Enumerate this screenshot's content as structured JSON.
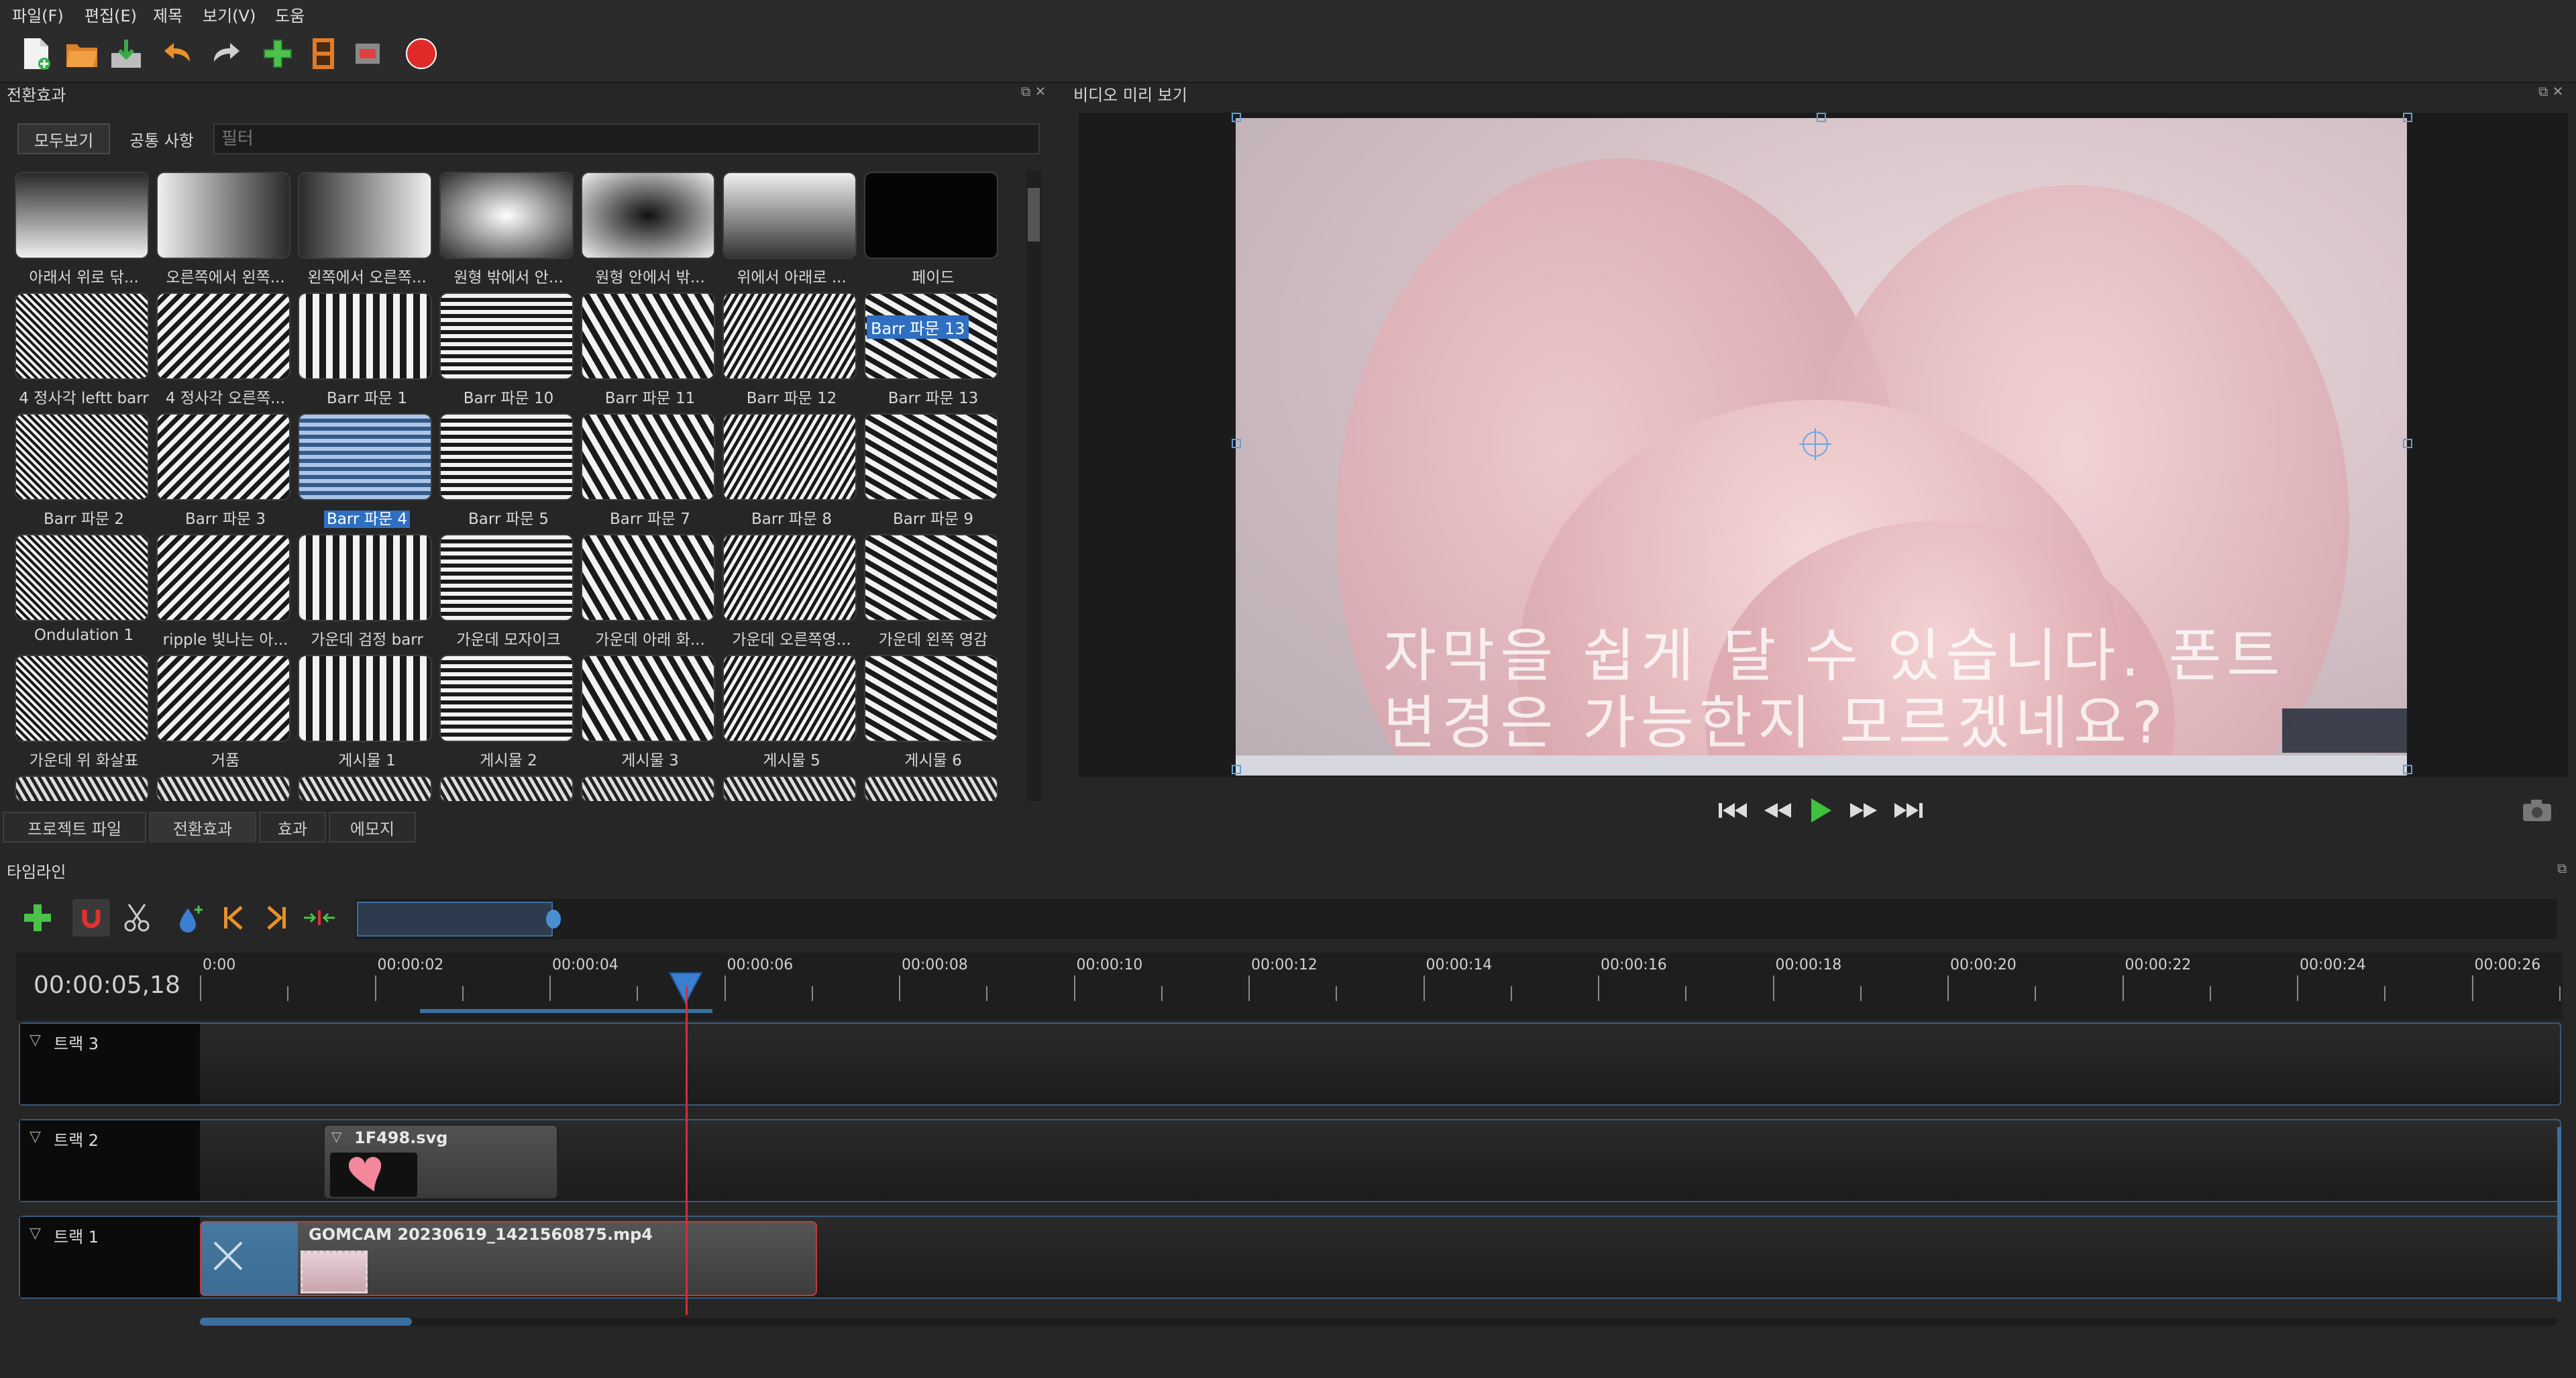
{
  "menu": [
    "파일(F)",
    "편집(E)",
    "제목",
    "보기(V)",
    "도움"
  ],
  "toolbar": {
    "icons": [
      "new-project-icon",
      "open-project-icon",
      "save-project-icon",
      "undo-icon",
      "redo-icon",
      "import-files-icon",
      "profile-icon",
      "fullscreen-icon",
      "export-video-icon"
    ]
  },
  "transitions": {
    "title": "전환효과",
    "show_all": "모두보기",
    "common": "공통 사항",
    "filter_placeholder": "필터",
    "hover_tooltip": "Barr 파문 13",
    "selected_label": "Barr 파문 4",
    "items": [
      "아래서 위로 닦...",
      "오른쪽에서 왼쪽...",
      "왼쪽에서 오른쪽...",
      "원형 밖에서 안...",
      "원형 안에서 밖...",
      "위에서 아래로 ...",
      "페이드",
      "4 정사각 leftt barr",
      "4 정사각 오른쪽...",
      "Barr 파문 1",
      "Barr 파문 10",
      "Barr 파문 11",
      "Barr 파문 12",
      "Barr 파문 13",
      "Barr 파문 2",
      "Barr 파문 3",
      "Barr 파문 4",
      "Barr 파문 5",
      "Barr 파문 7",
      "Barr 파문 8",
      "Barr 파문 9",
      "Ondulation 1",
      "ripple 빛나는 아...",
      "가운데 검정 barr",
      "가운데 모자이크",
      "가운데 아래 화...",
      "가운데 오른쪽영...",
      "가운데 왼쪽 영감",
      "가운데 위 화살표",
      "거품",
      "게시물 1",
      "게시물 2",
      "게시물 3",
      "게시물 5",
      "게시물 6"
    ]
  },
  "bottom_tabs": [
    "프로젝트 파일",
    "전환효과",
    "효과",
    "에모지"
  ],
  "video_preview": {
    "title": "비디오 미리 보기",
    "caption_line1": "자막을 쉽게 달 수 있습니다. 폰트",
    "caption_line2": "변경은 가능한지 모르겠네요?"
  },
  "timeline": {
    "title": "타임라인",
    "timecode": "00:00:05,18",
    "ruler_labels": [
      "0:00",
      "00:00:02",
      "00:00:04",
      "00:00:06",
      "00:00:08",
      "00:00:10",
      "00:00:12",
      "00:00:14",
      "00:00:16",
      "00:00:18",
      "00:00:20",
      "00:00:22",
      "00:00:24",
      "00:00:26"
    ],
    "tracks": [
      {
        "name": "트랙 3"
      },
      {
        "name": "트랙 2",
        "clip": "1F498.svg"
      },
      {
        "name": "트랙 1",
        "clip": "GOMCAM 20230619_1421560875.mp4"
      }
    ]
  },
  "colors": {
    "accent": "#2f6fc2",
    "playhead": "#d0303a",
    "clip_selected_border": "#c23a3a"
  }
}
